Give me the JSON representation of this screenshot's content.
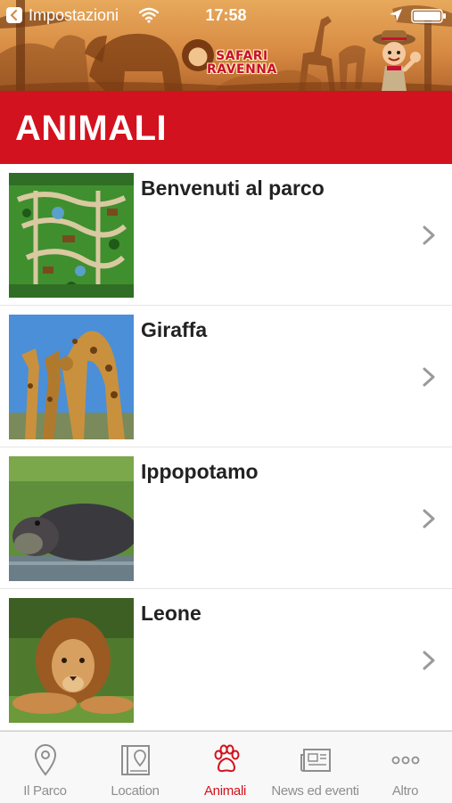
{
  "status_bar": {
    "back_label": "Impostazioni",
    "time": "17:58"
  },
  "header": {
    "logo_line1": "SAFARI",
    "logo_line2": "RAVENNA",
    "section_title": "ANIMALI"
  },
  "list": {
    "items": [
      {
        "title": "Benvenuti al parco",
        "thumbnail": "park-map"
      },
      {
        "title": "Giraffa",
        "thumbnail": "giraffes"
      },
      {
        "title": "Ippopotamo",
        "thumbnail": "hippo"
      },
      {
        "title": "Leone",
        "thumbnail": "lion"
      }
    ]
  },
  "tab_bar": {
    "tabs": [
      {
        "label": "Il Parco",
        "icon": "map-pin-icon",
        "active": false
      },
      {
        "label": "Location",
        "icon": "map-book-icon",
        "active": false
      },
      {
        "label": "Animali",
        "icon": "paw-icon",
        "active": true
      },
      {
        "label": "News ed eventi",
        "icon": "newspaper-icon",
        "active": false
      },
      {
        "label": "Altro",
        "icon": "more-icon",
        "active": false
      }
    ]
  },
  "colors": {
    "brand_red": "#d2121e",
    "tab_inactive": "#8e8e8e",
    "chevron": "#9a9a9a"
  }
}
